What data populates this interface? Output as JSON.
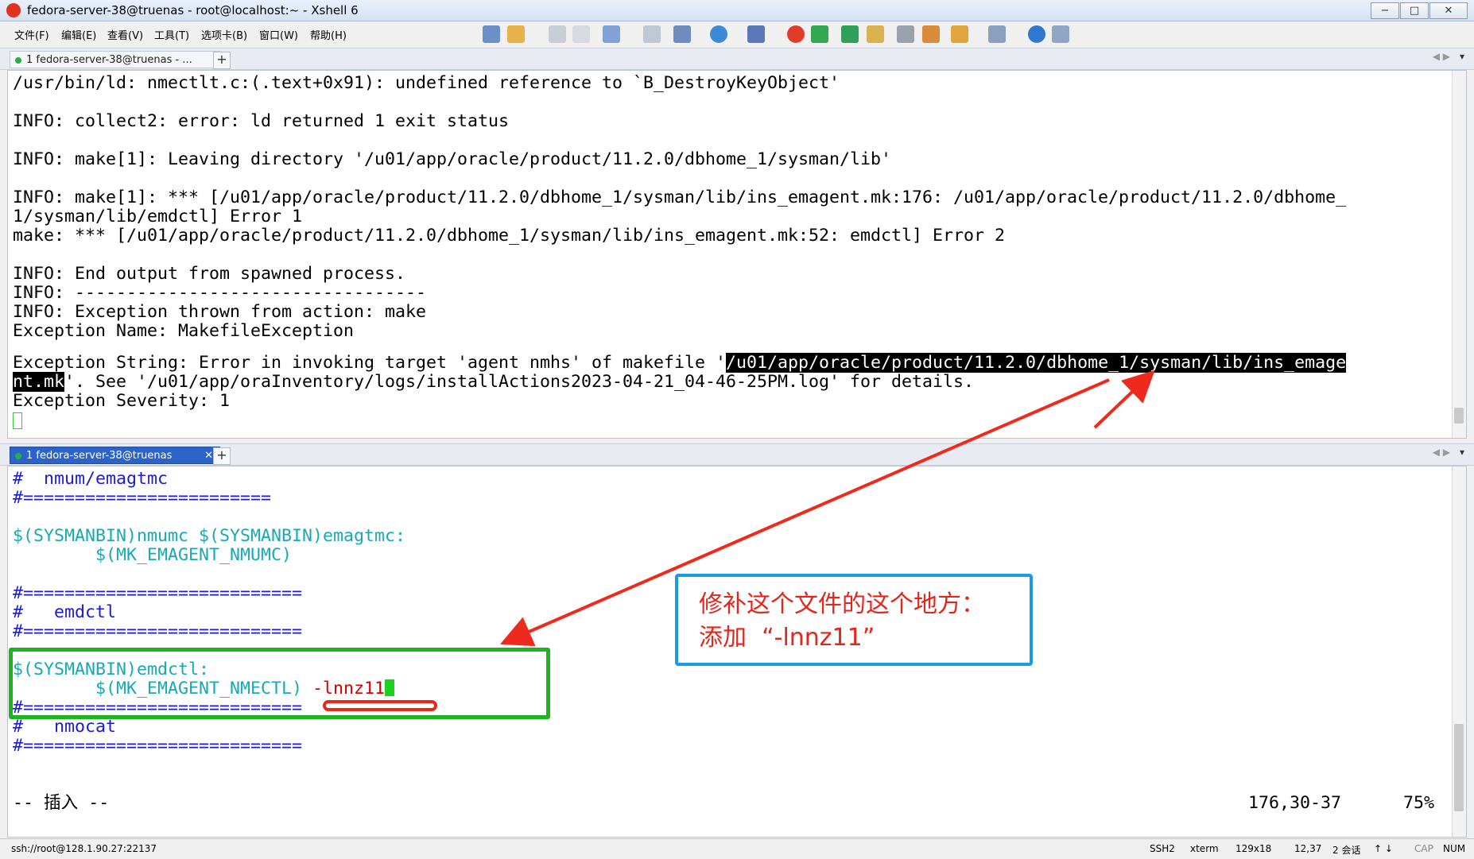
{
  "window": {
    "title": "fedora-server-38@truenas - root@localhost:~ - Xshell 6",
    "controls": [
      "−",
      "□",
      "✕"
    ]
  },
  "menu": [
    "文件(F)",
    "编辑(E)",
    "查看(V)",
    "工具(T)",
    "选项卡(B)",
    "窗口(W)",
    "帮助(H)"
  ],
  "toolbar_icons": [
    "new-session-icon",
    "open-folder-icon",
    "connect-icon",
    "disconnect-icon",
    "new-tab-icon",
    "find-icon",
    "transfer-icon",
    "globe-icon",
    "font-icon",
    "xftp-icon",
    "xshell-green-icon",
    "fullscreen-icon",
    "lock-icon",
    "keyboard-icon",
    "script-icon",
    "compose-icon",
    "layout-icon",
    "help-icon",
    "chat-icon"
  ],
  "top_pane": {
    "tab_label": "1 fedora-server-38@truenas - ...",
    "lines": [
      "/usr/bin/ld: nmectlt.c:(.text+0x91): undefined reference to `B_DestroyKeyObject'",
      "",
      "INFO: collect2: error: ld returned 1 exit status",
      "",
      "INFO: make[1]: Leaving directory '/u01/app/oracle/product/11.2.0/dbhome_1/sysman/lib'",
      "",
      "INFO: make[1]: *** [/u01/app/oracle/product/11.2.0/dbhome_1/sysman/lib/ins_emagent.mk:176: /u01/app/oracle/product/11.2.0/dbhome_",
      "1/sysman/lib/emdctl] Error 1",
      "make: *** [/u01/app/oracle/product/11.2.0/dbhome_1/sysman/lib/ins_emagent.mk:52: emdctl] Error 2",
      "",
      "INFO: End output from spawned process.",
      "INFO: ----------------------------------",
      "INFO: Exception thrown from action: make",
      "Exception Name: MakefileException"
    ],
    "exception_string_prefix": "Exception String: Error in invoking target 'agent nmhs' of makefile '",
    "highlight_1": "/u01/app/oracle/product/11.2.0/dbhome_1/sysman/lib/ins_emage",
    "highlight_2": "nt.mk",
    "exception_string_suffix": "'. See '/u01/app/oraInventory/logs/installActions2023-04-21_04-46-25PM.log' for details.",
    "severity_line": "Exception Severity: 1"
  },
  "bottom_pane": {
    "tab_label": "1 fedora-server-38@truenas",
    "lines": [
      {
        "text": "#  nmum/emagtmc",
        "color": "blue"
      },
      {
        "text": "#========================",
        "color": "blue"
      },
      {
        "text": "",
        "color": "blue"
      },
      {
        "text": "$(SYSMANBIN)nmumc $(SYSMANBIN)emagtmc:",
        "color": "cyan"
      },
      {
        "text": "        $(MK_EMAGENT_NMUMC)",
        "color": "cyan"
      },
      {
        "text": "",
        "color": "blue"
      },
      {
        "text": "#===========================",
        "color": "blue"
      },
      {
        "text": "#   emdctl",
        "color": "blue"
      },
      {
        "text": "#===========================",
        "color": "blue"
      },
      {
        "text": "",
        "color": "blue"
      },
      {
        "text": "$(SYSMANBIN)emdctl:",
        "color": "cyan"
      }
    ],
    "edited_line_prefix": "        $(MK_EMAGENT_NMECTL) ",
    "edited_line_added": "-lnnz11",
    "lines_after": [
      {
        "text": "#===========================",
        "color": "blue"
      },
      {
        "text": "#   nmocat",
        "color": "blue"
      },
      {
        "text": "#===========================",
        "color": "blue"
      }
    ],
    "mode": "-- 插入 --",
    "position": "176,30-37",
    "percent": "75%"
  },
  "annotation": {
    "line1": "修补这个文件的这个地方：",
    "line2": "添加  “-lnnz11”",
    "border_color": "#1a9be9",
    "text_color": "#e3251b",
    "box_color": "#1fb41f"
  },
  "status": {
    "connection": "ssh://root@128.1.90.27:22137",
    "ssh": "SSH2",
    "term": "xterm",
    "size": "129x18",
    "cursor": "12,37",
    "sessions": "2 会话",
    "cap": "CAP",
    "num": "NUM"
  }
}
